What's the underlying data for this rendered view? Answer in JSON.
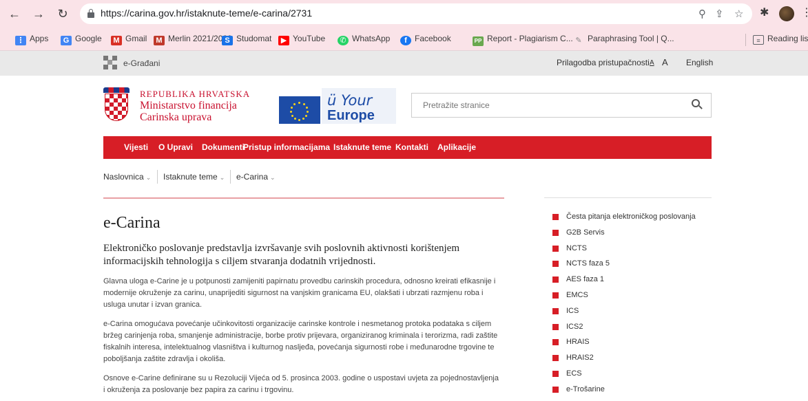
{
  "browser": {
    "url": "https://carina.gov.hr/istaknute-teme/e-carina/2731",
    "bookmarks": [
      {
        "label": "Apps",
        "icon": "apps-grid-icon",
        "color": "#4285f4"
      },
      {
        "label": "Google",
        "icon": "google-icon",
        "color": "#4285f4"
      },
      {
        "label": "Gmail",
        "icon": "gmail-icon",
        "color": "#d93025"
      },
      {
        "label": "Merlin 2021/2022",
        "icon": "merlin-icon",
        "color": "#c0392b"
      },
      {
        "label": "Studomat",
        "icon": "studomat-icon",
        "color": "#1a73e8"
      },
      {
        "label": "YouTube",
        "icon": "youtube-icon",
        "color": "#ff0000"
      },
      {
        "label": "WhatsApp",
        "icon": "whatsapp-icon",
        "color": "#25d366"
      },
      {
        "label": "Facebook",
        "icon": "facebook-icon",
        "color": "#1877f2"
      },
      {
        "label": "Report - Plagiarism C...",
        "icon": "plagiarism-icon",
        "color": "#6aa84f"
      },
      {
        "label": "Paraphrasing Tool | Q...",
        "icon": "quillbot-icon",
        "color": "#888888"
      },
      {
        "label": "Reading lis",
        "icon": "reading-list-icon",
        "color": "#5f6368"
      }
    ]
  },
  "util": {
    "portal": "e-Građani",
    "accessibility": "Prilagodba pristupačnosti",
    "font_small": "A",
    "font_large": "A",
    "language": "English"
  },
  "header": {
    "line1": "REPUBLIKA HRVATSKA",
    "line2": "Ministarstvo financija",
    "line3": "Carinska uprava",
    "your": "Your",
    "europe": "Europe",
    "search_placeholder": "Pretražite stranice"
  },
  "nav": [
    "Vijesti",
    "O Upravi",
    "Dokumenti",
    "Pristup informacijama",
    "Istaknute teme",
    "Kontakti",
    "Aplikacije"
  ],
  "breadcrumb": [
    "Naslovnica",
    "Istaknute teme",
    "e-Carina"
  ],
  "article": {
    "title": "e-Carina",
    "lead": "Elektroničko poslovanje predstavlja izvršavanje svih poslovnih aktivnosti korištenjem informacijskih tehnologija s ciljem stvaranja dodatnih vrijednosti.",
    "p1": "Glavna uloga e-Carine je u potpunosti zamijeniti papirnatu provedbu carinskih procedura, odnosno kreirati efikasnije i modernije okruženje za carinu, unaprijediti sigurnost na vanjskim granicama EU, olakšati i ubrzati razmjenu roba i usluga unutar i izvan granica.",
    "p2": "e-Carina omogućava povećanje učinkovitosti organizacije carinske kontrole i nesmetanog protoka podataka s ciljem bržeg carinjenja roba, smanjenje administracije, borbe protiv prijevara, organiziranog kriminala i terorizma, radi zaštite fiskalnih interesa, intelektualnog vlasništva i kulturnog nasljeđa, povećanja sigurnosti robe i međunarodne trgovine te poboljšanja zaštite zdravlja i okoliša.",
    "p3": "Osnove e-Carine definirane su u Rezoluciji Vijeća od 5. prosinca 2003. godine o uspostavi uvjeta za pojednostavljenja i okruženja za poslovanje bez papira za carinu i trgovinu."
  },
  "sidebar": [
    "Česta pitanja elektroničkog poslovanja",
    "G2B Servis",
    "NCTS",
    "NCTS faza 5",
    "AES faza 1",
    "EMCS",
    "ICS",
    "ICS2",
    "HRAIS",
    "HRAIS2",
    "ECS",
    "e-Trošarine"
  ],
  "colors": {
    "brand_red": "#d71e26",
    "chrome_pink": "#fae3e8",
    "eu_blue": "#1d4ca6"
  }
}
